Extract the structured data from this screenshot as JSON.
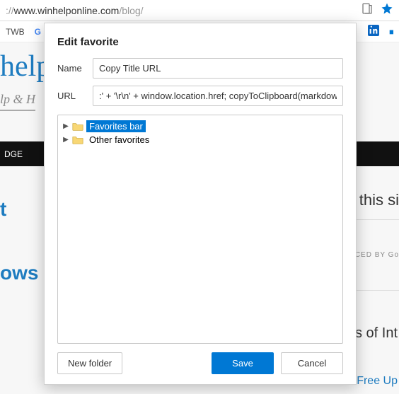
{
  "address_bar": {
    "url_gray_prefix": "://",
    "url_dark": "www.winhelponline.com",
    "url_gray_suffix": "/blog/"
  },
  "bookmark_bar": {
    "item1": "TWB"
  },
  "background": {
    "logo": "help",
    "tagline": "lp & H",
    "darkbar": "DGE",
    "side_a": "t",
    "side_b": "ows",
    "side1": "this si",
    "side2": "RCED BY  Go",
    "side3": "s of Int",
    "side4": "How to Free Up"
  },
  "dialog": {
    "title": "Edit favorite",
    "name_label": "Name",
    "name_value": "Copy Title URL",
    "url_label": "URL",
    "url_value": ":' + '\\r\\n' + window.location.href; copyToClipboard(markdown); })();",
    "tree": {
      "item1": "Favorites bar",
      "item2": "Other favorites"
    },
    "new_folder": "New folder",
    "save": "Save",
    "cancel": "Cancel"
  }
}
